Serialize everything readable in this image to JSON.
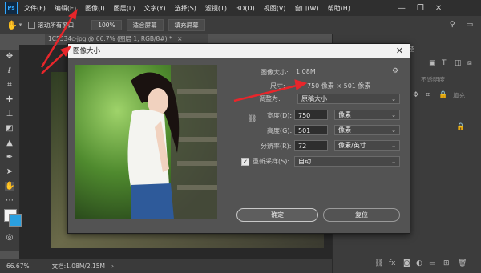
{
  "menubar": {
    "logo": "Ps",
    "items": [
      "文件(F)",
      "编辑(E)",
      "图像(I)",
      "图层(L)",
      "文字(Y)",
      "选择(S)",
      "滤镜(T)",
      "3D(D)",
      "视图(V)",
      "窗口(W)",
      "帮助(H)"
    ],
    "window_controls": [
      "—",
      "❐",
      "✕"
    ]
  },
  "options": {
    "checkbox_label": "滚动所有窗口",
    "zoom_value": "100%",
    "fit_screen": "适合屏幕",
    "fill_screen": "填充屏幕"
  },
  "document": {
    "tab_title": "1C5534c-jpg @ 66.7% (图层 1, RGB/8#) *",
    "tab_close": "×"
  },
  "statusbar": {
    "zoom": "66.67%",
    "doc_info": "文档:1.08M/2.15M",
    "arrow": "›"
  },
  "right_panel": {
    "tab_partial": "径",
    "opacity_label": "不透明度",
    "fill_label": "填充"
  },
  "dialog": {
    "title": "图像大小",
    "close": "✕",
    "image_size_label": "图像大小:",
    "image_size_value": "1.08M",
    "dimensions_label": "尺寸:",
    "dimensions_value": "750 像素 × 501 像素",
    "fit_to_label": "调整为:",
    "fit_to_value": "原稿大小",
    "width_label": "宽度(D):",
    "width_value": "750",
    "width_unit": "像素",
    "height_label": "高度(G):",
    "height_value": "501",
    "height_unit": "像素",
    "resolution_label": "分辨率(R):",
    "resolution_value": "72",
    "resolution_unit": "像素/英寸",
    "resample_label": "重新采样(S):",
    "resample_value": "自动",
    "ok_label": "确定",
    "reset_label": "复位"
  },
  "colors": {
    "annotation_arrow": "#e8262b",
    "accent": "#31a8ff",
    "dialog_bg": "#535353"
  }
}
